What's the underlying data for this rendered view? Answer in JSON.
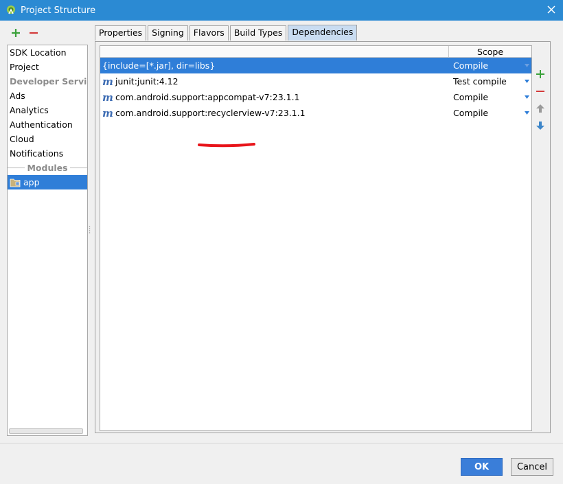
{
  "window": {
    "title": "Project Structure",
    "accent": "#2b8ad3"
  },
  "left_panel": {
    "add_icon": "plus-icon",
    "remove_icon": "minus-icon",
    "items": [
      {
        "label": "SDK Location"
      },
      {
        "label": "Project"
      }
    ],
    "developer_services_header": "Developer Services",
    "services": [
      {
        "label": "Ads"
      },
      {
        "label": "Analytics"
      },
      {
        "label": "Authentication"
      },
      {
        "label": "Cloud"
      },
      {
        "label": "Notifications"
      }
    ],
    "modules_header": "Modules",
    "modules": [
      {
        "label": "app",
        "selected": true,
        "icon": "module-folder-icon"
      }
    ]
  },
  "tabs": [
    {
      "label": "Properties"
    },
    {
      "label": "Signing"
    },
    {
      "label": "Flavors"
    },
    {
      "label": "Build Types"
    },
    {
      "label": "Dependencies",
      "active": true
    }
  ],
  "dependencies": {
    "scope_header": "Scope",
    "rows": [
      {
        "name": "{include=[*.jar], dir=libs}",
        "scope": "Compile",
        "icon": "",
        "selected": true
      },
      {
        "name": "junit:junit:4.12",
        "scope": "Test compile",
        "icon": "maven-icon"
      },
      {
        "name": "com.android.support:appcompat-v7:23.1.1",
        "scope": "Compile",
        "icon": "maven-icon"
      },
      {
        "name": "com.android.support:recyclerview-v7:23.1.1",
        "scope": "Compile",
        "icon": "maven-icon"
      }
    ],
    "tools": [
      "plus-icon",
      "minus-icon",
      "arrow-up-icon",
      "arrow-down-icon"
    ]
  },
  "footer": {
    "ok_label": "OK",
    "cancel_label": "Cancel"
  },
  "colors": {
    "selection": "#2f7ed8",
    "add_green": "#3aa13a",
    "remove_red": "#d33a3a",
    "annotation_red": "#e8141a"
  }
}
